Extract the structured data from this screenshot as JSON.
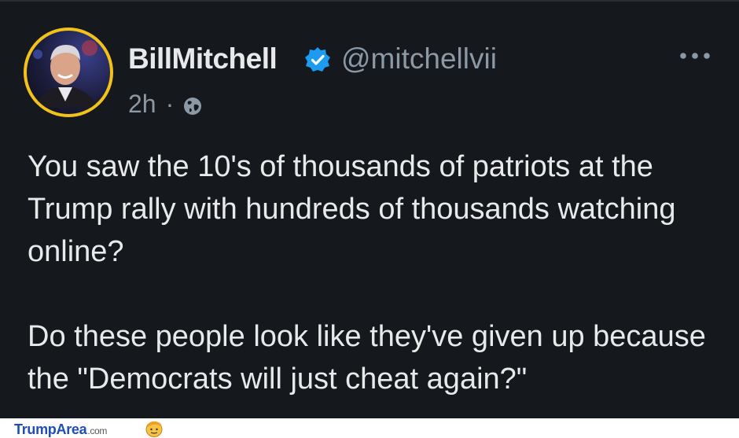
{
  "tweet": {
    "display_name": "BillMitchell",
    "handle": "@mitchellvii",
    "time": "2h",
    "separator": "·",
    "paragraphs": [
      "You saw the 10's of thousands of patriots at the Trump rally with hundreds of thousands watching online?",
      "Do these people look like they've given up because the \"Democrats will just cheat again?\""
    ],
    "verified_icon": "verified-badge-icon",
    "visibility_icon": "globe-icon",
    "menu_icon": "more-options-icon"
  },
  "watermark": {
    "brand": "TrumpArea",
    "suffix": ".com"
  },
  "colors": {
    "background": "#15181c",
    "text": "#e7e9ea",
    "muted": "#8b98a5",
    "verified": "#1d9bf0",
    "avatar_ring": "#f2c21a",
    "watermark": "#1f4fb4"
  }
}
